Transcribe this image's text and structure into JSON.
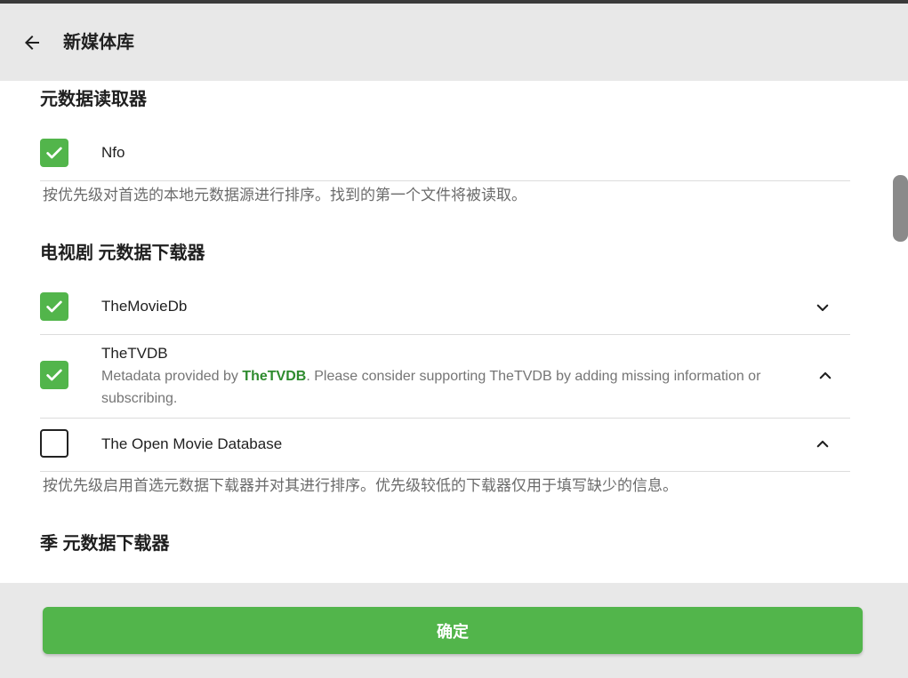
{
  "header": {
    "title": "新媒体库"
  },
  "metadata_readers": {
    "title": "元数据读取器",
    "items": [
      {
        "label": "Nfo",
        "checked": true
      }
    ],
    "help": "按优先级对首选的本地元数据源进行排序。找到的第一个文件将被读取。"
  },
  "tv_downloaders": {
    "title": "电视剧 元数据下载器",
    "items": [
      {
        "label": "TheMovieDb",
        "checked": true,
        "chevron": "chevron-down"
      },
      {
        "label": "TheTVDB",
        "checked": true,
        "chevron": "chevron-up",
        "desc_before": "Metadata provided by ",
        "desc_link": "TheTVDB",
        "desc_after": ". Please consider supporting TheTVDB by adding missing information or subscribing."
      },
      {
        "label": "The Open Movie Database",
        "checked": false,
        "chevron": "chevron-up"
      }
    ],
    "help": "按优先级启用首选元数据下载器并对其进行排序。优先级较低的下载器仅用于填写缺少的信息。"
  },
  "season_downloaders": {
    "title": "季 元数据下载器"
  },
  "footer": {
    "ok_label": "确定"
  },
  "colors": {
    "accent": "#52b54b",
    "link": "#2e8b2e",
    "header_bg": "#e8e8e8"
  }
}
